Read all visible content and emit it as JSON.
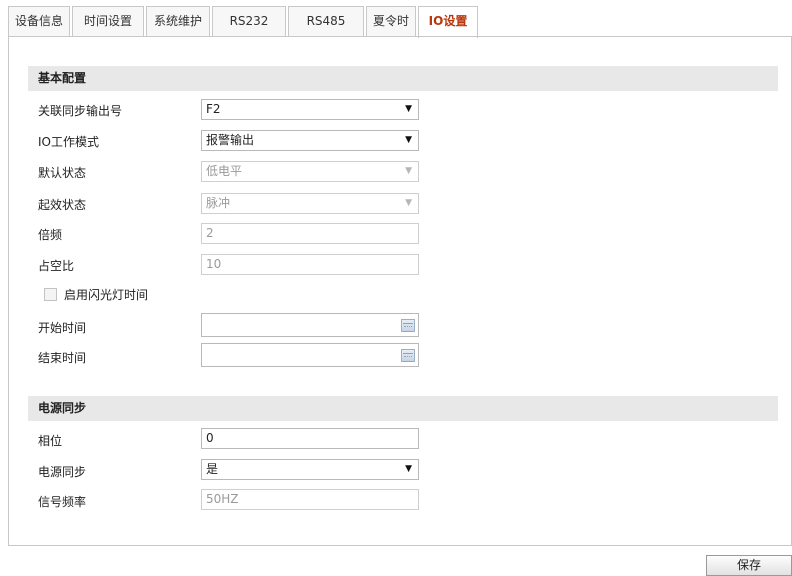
{
  "tabs": [
    {
      "label": "设备信息"
    },
    {
      "label": "时间设置"
    },
    {
      "label": "系统维护"
    },
    {
      "label": "RS232"
    },
    {
      "label": "RS485"
    },
    {
      "label": "夏令时"
    },
    {
      "label": "IO设置",
      "active": true
    }
  ],
  "basic": {
    "title": "基本配置",
    "linked_output": {
      "label": "关联同步输出号",
      "value": "F2"
    },
    "io_mode": {
      "label": "IO工作模式",
      "value": "报警输出"
    },
    "default_state": {
      "label": "默认状态",
      "value": "低电平"
    },
    "effective_state": {
      "label": "起效状态",
      "value": "脉冲"
    },
    "multiplier": {
      "label": "倍频",
      "value": "2"
    },
    "duty_ratio": {
      "label": "占空比",
      "value": "10"
    },
    "enable_flash": {
      "label": "启用闪光灯时间",
      "checked": false
    },
    "start_time": {
      "label": "开始时间",
      "value": ""
    },
    "end_time": {
      "label": "结束时间",
      "value": ""
    }
  },
  "power_sync": {
    "title": "电源同步",
    "phase": {
      "label": "相位",
      "value": "0"
    },
    "sync": {
      "label": "电源同步",
      "value": "是"
    },
    "frequency": {
      "label": "信号频率",
      "value": "50HZ"
    }
  },
  "actions": {
    "save_label": "保存"
  },
  "colors": {
    "active_tab_text": "#b8360c",
    "section_bg": "#e8e8e8"
  }
}
